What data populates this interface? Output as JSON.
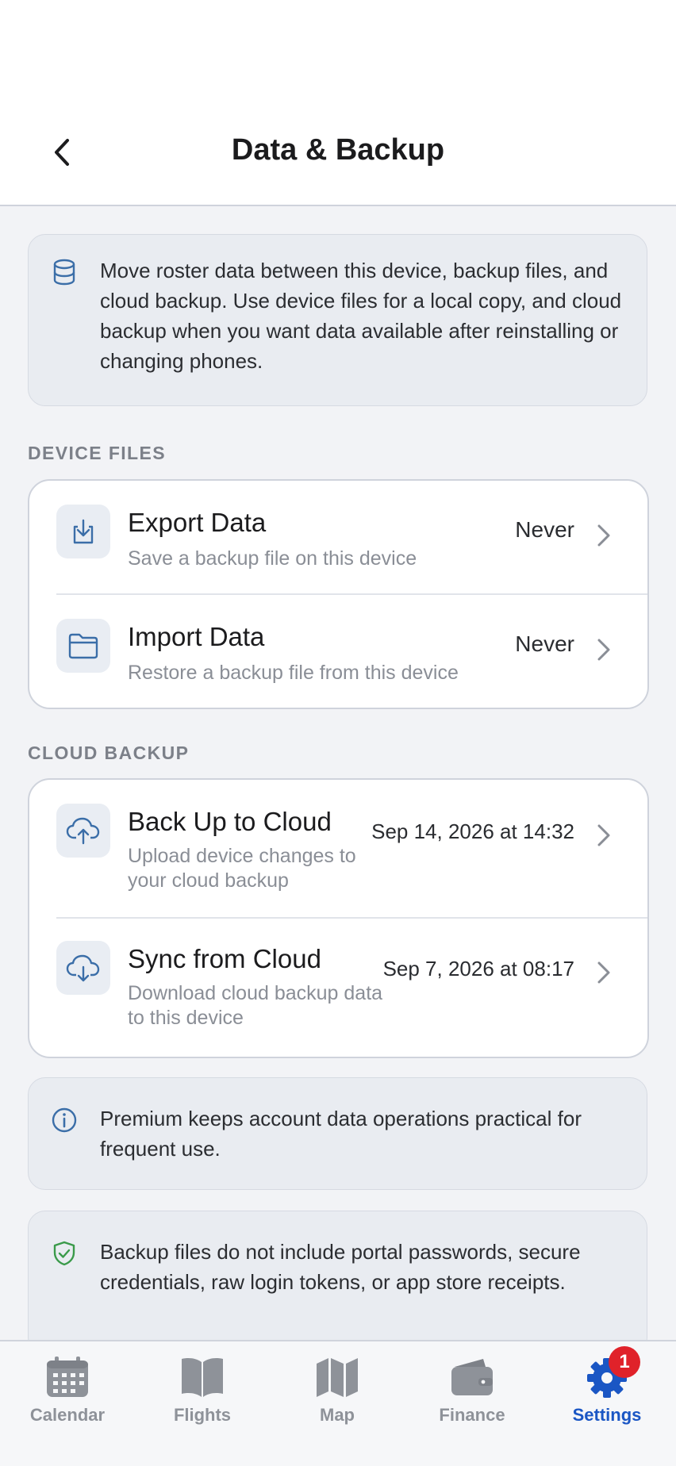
{
  "header": {
    "title": "Data & Backup",
    "back_icon": "chevron-left-icon"
  },
  "intro": {
    "icon": "database-icon",
    "text": "Move roster data between this device, backup files, and cloud backup. Use device files for a local copy, and cloud backup when you want data available after reinstalling or changing phones."
  },
  "device_files": {
    "label": "DEVICE FILES",
    "items": [
      {
        "icon": "export-icon",
        "title": "Export Data",
        "subtitle": "Save a backup file on this device",
        "value": "Never"
      },
      {
        "icon": "folder-icon",
        "title": "Import Data",
        "subtitle": "Restore a backup file from this device",
        "value": "Never"
      }
    ]
  },
  "cloud_backup": {
    "label": "CLOUD BACKUP",
    "items": [
      {
        "icon": "cloud-upload-icon",
        "title": "Back Up to Cloud",
        "subtitle": "Upload device changes to your cloud backup",
        "value": "Sep 14, 2026 at 14:32"
      },
      {
        "icon": "cloud-download-icon",
        "title": "Sync from Cloud",
        "subtitle": "Download cloud backup data to this device",
        "value": "Sep 7, 2026 at 08:17"
      }
    ]
  },
  "premium_note": {
    "icon": "info-icon",
    "text": "Premium keeps account data operations practical for frequent use."
  },
  "security_note": {
    "icon": "shield-check-icon",
    "text": "Backup files do not include portal passwords, secure credentials, raw login tokens, or app store receipts."
  },
  "tabs": [
    {
      "label": "Calendar",
      "icon": "calendar-icon"
    },
    {
      "label": "Flights",
      "icon": "book-icon"
    },
    {
      "label": "Map",
      "icon": "map-icon"
    },
    {
      "label": "Finance",
      "icon": "wallet-icon"
    },
    {
      "label": "Settings",
      "icon": "gear-icon",
      "badge": "1",
      "active": true
    }
  ],
  "colors": {
    "accent": "#1a56c4",
    "badge": "#e0222a",
    "success": "#3a9a4a"
  }
}
